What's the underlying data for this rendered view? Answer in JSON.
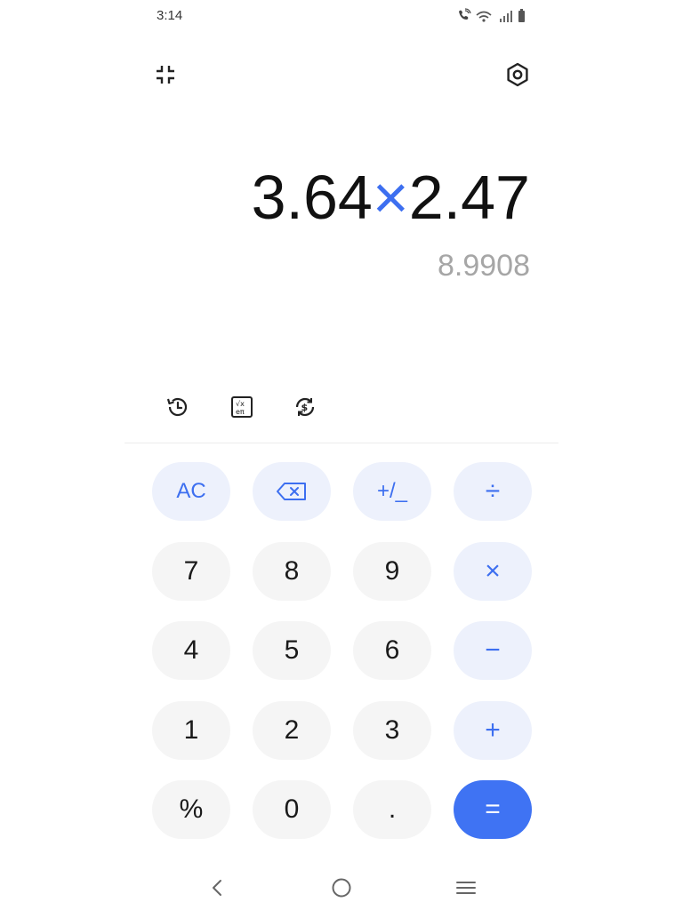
{
  "status_bar": {
    "time": "3:14",
    "icons": [
      "wifi-calling-icon",
      "wifi-icon",
      "signal-icon",
      "battery-icon"
    ]
  },
  "top_bar": {
    "collapse_icon": "collapse-icon",
    "settings_icon": "settings-icon"
  },
  "display": {
    "operand_1": "3.64",
    "operator": "×",
    "operand_2": "2.47",
    "result": "8.9908"
  },
  "tools": {
    "icons": [
      "history-icon",
      "scientific-icon",
      "currency-convert-icon"
    ]
  },
  "keypad": {
    "keys": [
      "AC",
      "",
      "+/_",
      "÷",
      "7",
      "8",
      "9",
      "×",
      "4",
      "5",
      "6",
      "−",
      "1",
      "2",
      "3",
      "+",
      "%",
      "0",
      ".",
      "="
    ],
    "backspace_icon": "backspace-icon"
  },
  "colors": {
    "accent": "#3d6ff0",
    "equals_bg": "#3f73f3",
    "operator_key_bg": "#edf1fc",
    "number_key_bg": "#f5f5f5",
    "result_text": "#a6a6a6"
  },
  "nav_bar": {
    "icons": [
      "back-icon",
      "home-icon",
      "recents-icon"
    ]
  }
}
